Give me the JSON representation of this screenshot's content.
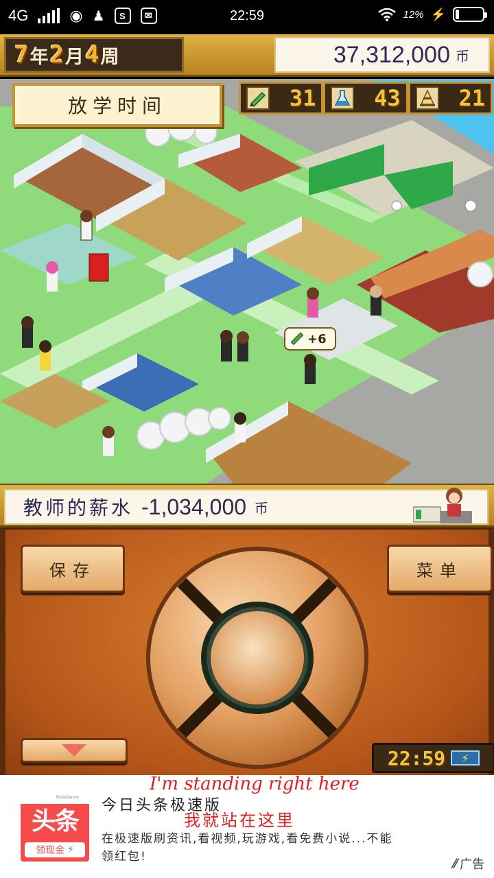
{
  "status_bar": {
    "network": "4G",
    "time": "22:59",
    "battery_percent": "12%",
    "qq_badge": "S"
  },
  "game": {
    "date": {
      "year_num": "7",
      "year_unit": "年",
      "month_num": "2",
      "month_unit": "月",
      "week_num": "4",
      "week_unit": "周"
    },
    "money": {
      "value": "37,312,000",
      "unit": "币"
    },
    "time_period": "放学时间",
    "stats": [
      {
        "icon": "pencil-icon",
        "value": "31"
      },
      {
        "icon": "flask-icon",
        "value": "43"
      },
      {
        "icon": "cone-icon",
        "value": "21"
      }
    ],
    "bonus_popup": "+6",
    "salary": {
      "label": "教师的薪水",
      "value": "-1,034,000",
      "unit": "币"
    }
  },
  "controls": {
    "save_label": "保存",
    "menu_label": "菜单",
    "clock": "22:59"
  },
  "ad": {
    "logo_text": "头条",
    "logo_sub": "领现金",
    "logo_top": "ByteDance",
    "title": "今日头条极速版",
    "description": "在极速版刷资讯,看视频,玩游戏,看免费小说...不能领红包!",
    "annotation_en": "I'm standing right here",
    "annotation_zh": "我就站在这里",
    "ad_label": "广告"
  },
  "colors": {
    "gold_frame": "#e0b243",
    "digit_yellow": "#f4c53a",
    "panel_cream": "#fbf6e9",
    "navy_text": "#2b2a55",
    "controller_orange": "#d97f2f",
    "annotation_red": "#e02020",
    "ad_red": "#f54b4b"
  }
}
